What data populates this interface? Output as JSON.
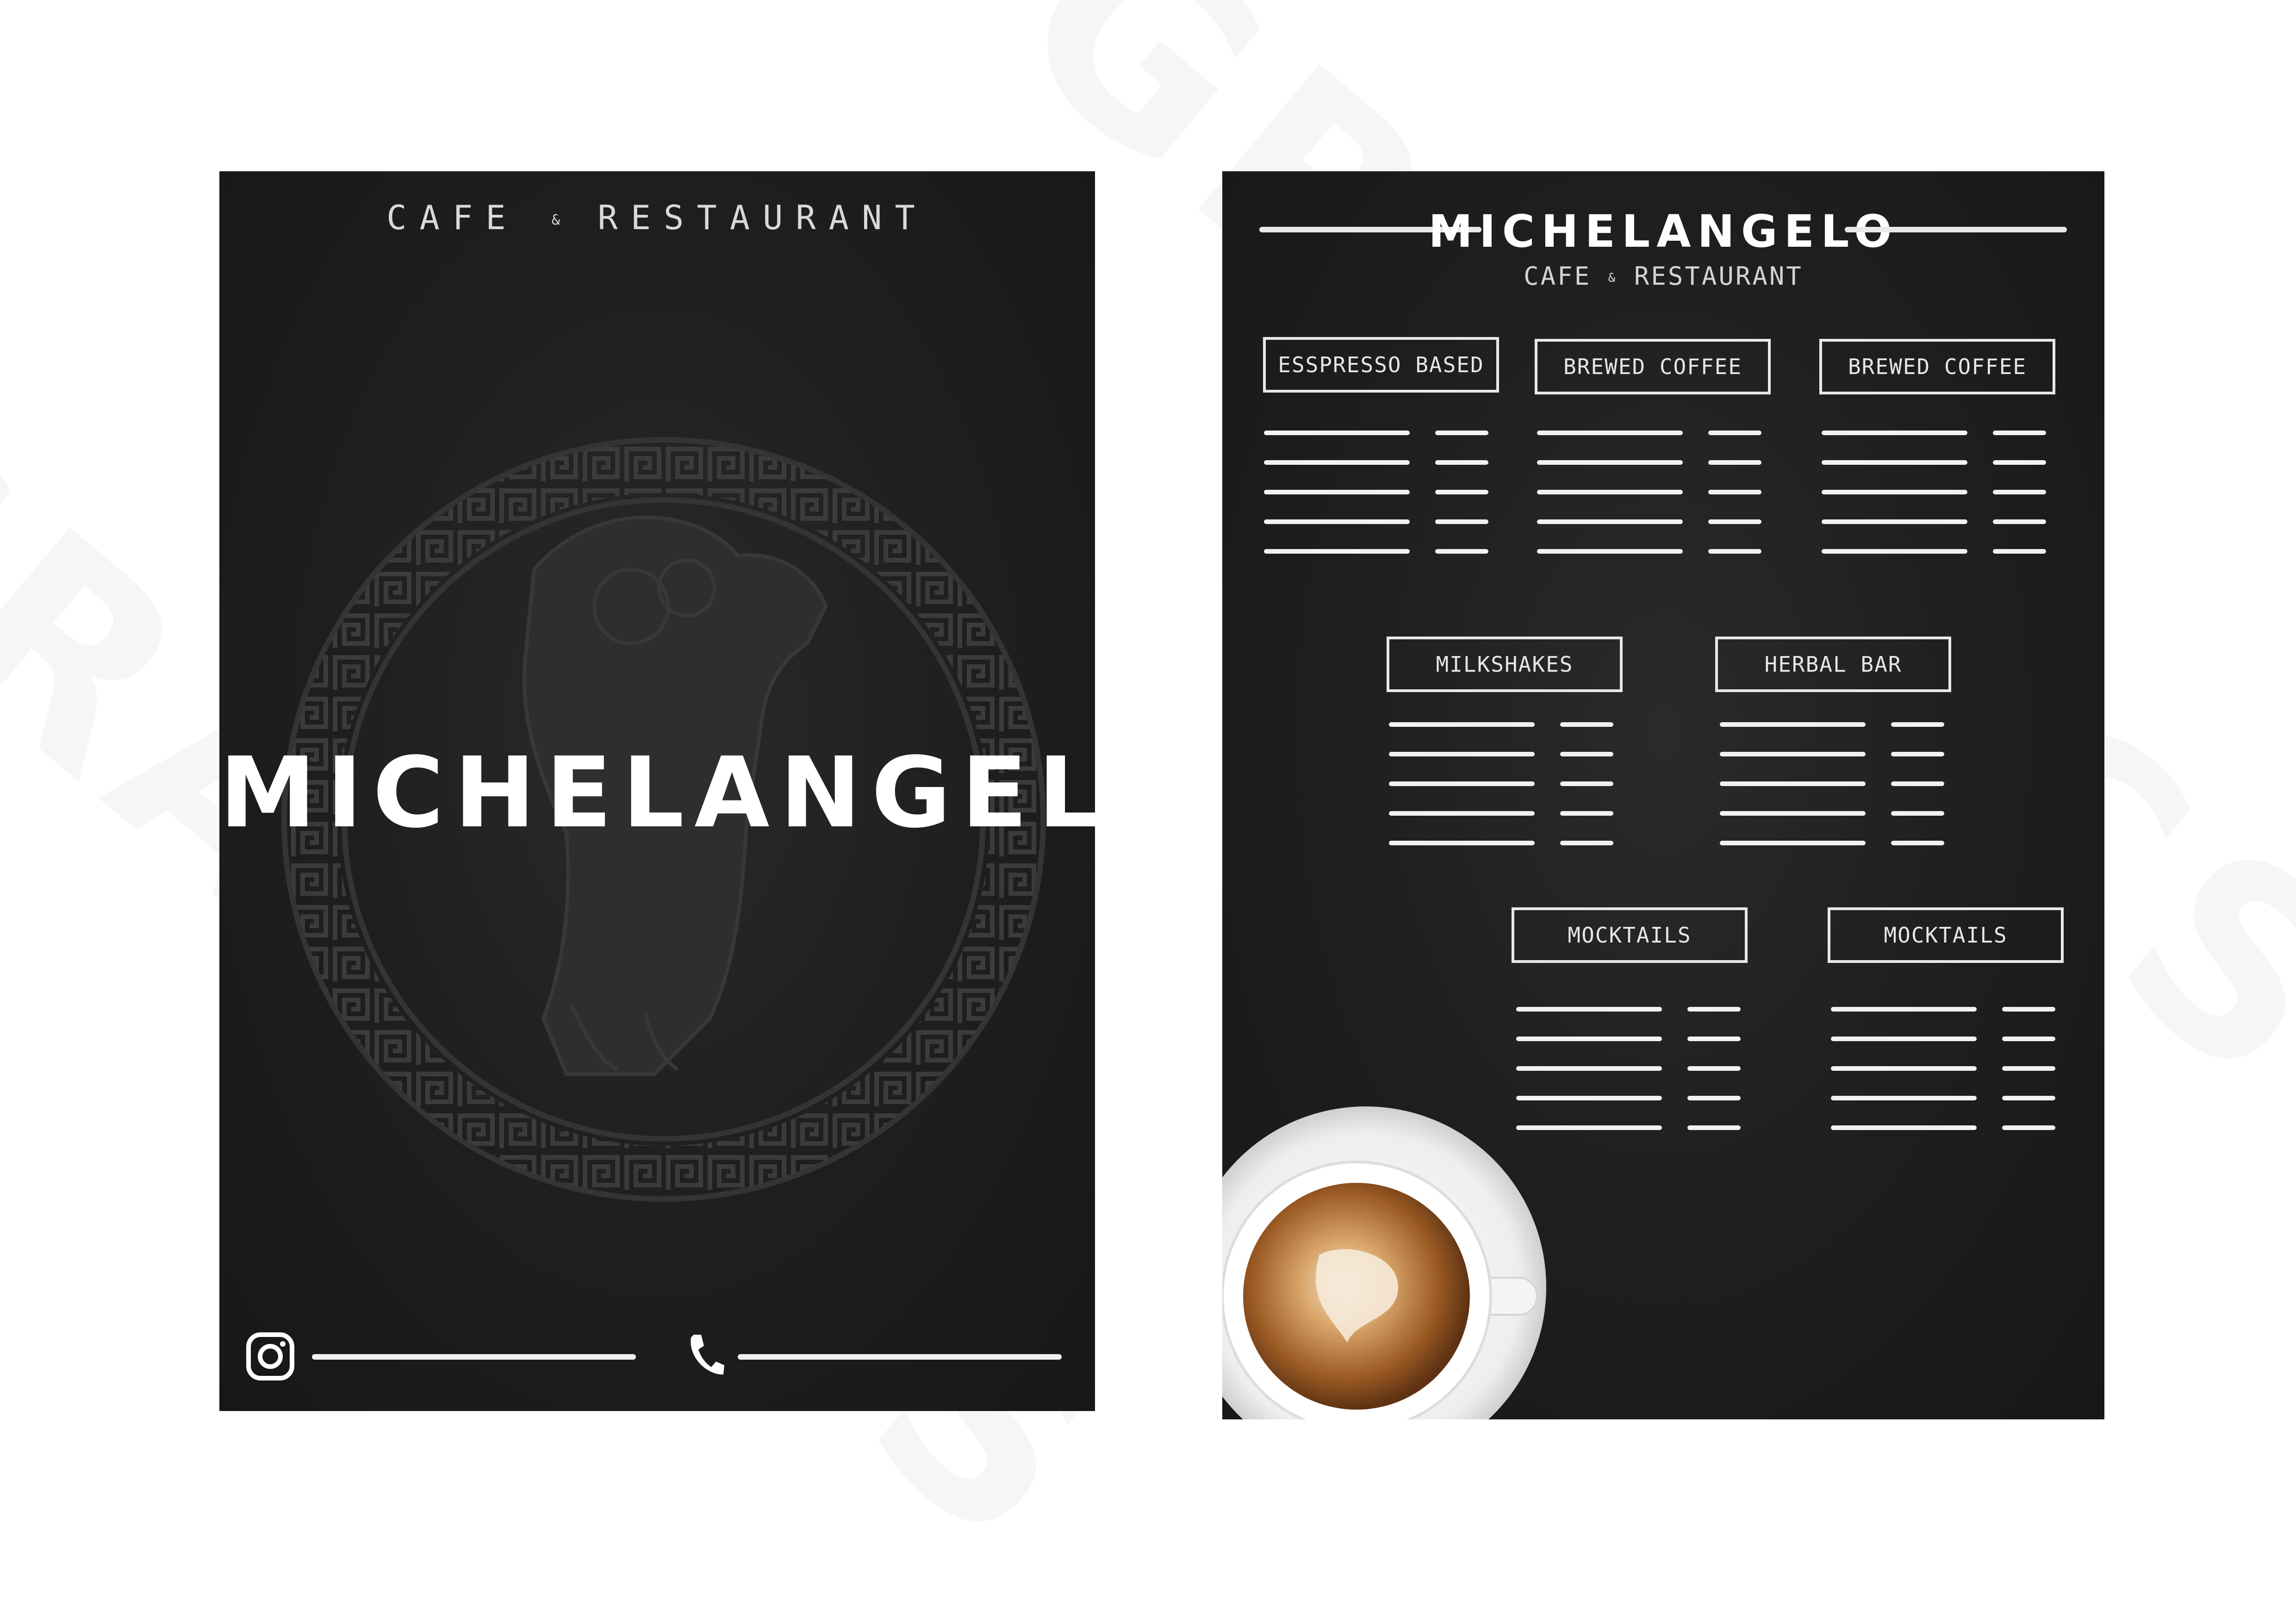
{
  "front": {
    "subtitle_left": "CAFE",
    "subtitle_amp": "&",
    "subtitle_right": "RESTAURANT",
    "title": "MICHELANGELO",
    "icons": {
      "social": "instagram-icon",
      "phone": "phone-icon"
    }
  },
  "back": {
    "title": "MICHELANGELO",
    "subtitle_left": "CAFE",
    "subtitle_amp": "&",
    "subtitle_right": "RESTAURANT",
    "categories": [
      {
        "label": "ESSPRESSO BASED"
      },
      {
        "label": "BREWED COFFEE"
      },
      {
        "label": "BREWED COFFEE"
      },
      {
        "label": "MILKSHAKES"
      },
      {
        "label": "HERBAL BAR"
      },
      {
        "label": "MOCKTAILS"
      },
      {
        "label": "MOCKTAILS"
      }
    ],
    "image": "coffee-cup"
  },
  "colors": {
    "page": "#1e1e1e",
    "text": "#ffffff",
    "background": "#ffffff"
  }
}
